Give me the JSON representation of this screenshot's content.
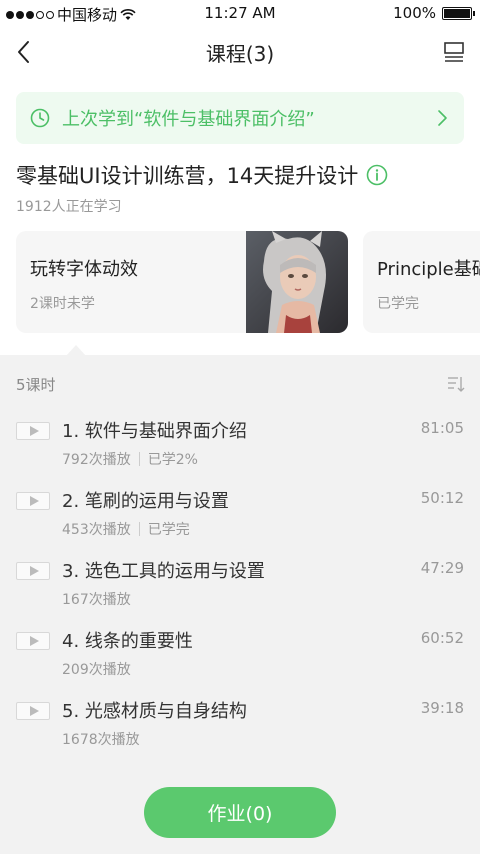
{
  "status_bar": {
    "carrier": "中国移动",
    "time": "11:27 AM",
    "battery": "100%"
  },
  "nav": {
    "title": "课程(3)"
  },
  "last_study": {
    "text": "上次学到“软件与基础界面介绍”"
  },
  "course": {
    "title": "零基础UI设计训练营，14天提升设计",
    "learners": "1912人正在学习"
  },
  "cards": [
    {
      "name": "玩转字体动效",
      "status": "2课时未学"
    },
    {
      "name": "Principle基础",
      "status": "已学完"
    }
  ],
  "lessons_header": {
    "count": "5课时"
  },
  "lessons": [
    {
      "title": "1. 软件与基础界面介绍",
      "duration": "81:05",
      "plays": "792次播放",
      "progress": "已学2%"
    },
    {
      "title": "2. 笔刷的运用与设置",
      "duration": "50:12",
      "plays": "453次播放",
      "progress": "已学完"
    },
    {
      "title": "3. 选色工具的运用与设置",
      "duration": "47:29",
      "plays": "167次播放"
    },
    {
      "title": "4. 线条的重要性",
      "duration": "60:52",
      "plays": "209次播放"
    },
    {
      "title": "5. 光感材质与自身结构",
      "duration": "39:18",
      "plays": "1678次播放"
    }
  ],
  "homework": {
    "label": "作业(0)"
  },
  "colors": {
    "accent": "#5bc96e",
    "accent_text": "#4cbf66",
    "banner_bg": "#eefaf0",
    "panel_bg": "#f2f2f2"
  }
}
